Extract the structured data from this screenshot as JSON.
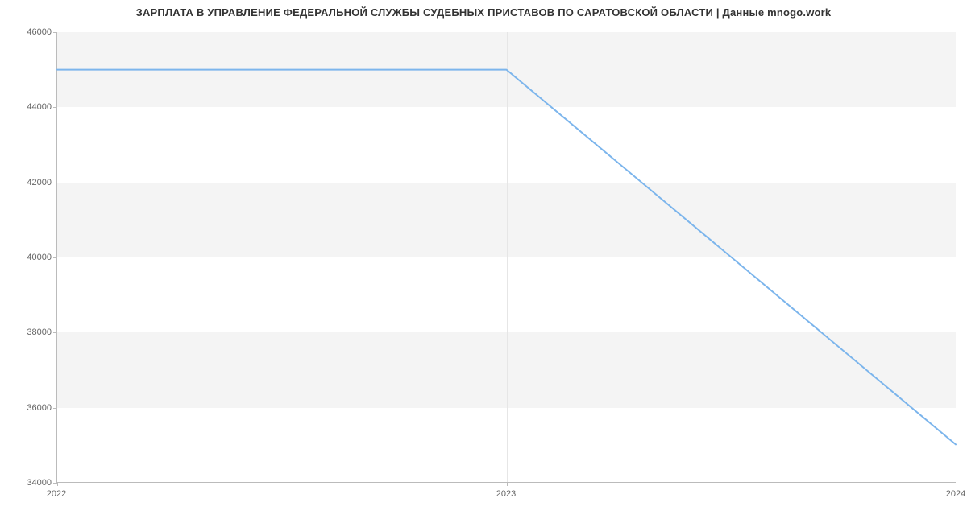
{
  "chart_data": {
    "type": "line",
    "title": "ЗАРПЛАТА В УПРАВЛЕНИЕ ФЕДЕРАЛЬНОЙ СЛУЖБЫ СУДЕБНЫХ ПРИСТАВОВ ПО САРАТОВСКОЙ ОБЛАСТИ | Данные mnogo.work",
    "x": [
      2022,
      2023,
      2024
    ],
    "values": [
      45000,
      45000,
      35000
    ],
    "x_ticks": [
      2022,
      2023,
      2024
    ],
    "y_ticks": [
      34000,
      36000,
      38000,
      40000,
      42000,
      44000,
      46000
    ],
    "xlim": [
      2022,
      2024
    ],
    "ylim": [
      34000,
      46000
    ],
    "xlabel": "",
    "ylabel": "",
    "line_color": "#7cb5ec",
    "band_color": "#f4f4f4"
  }
}
